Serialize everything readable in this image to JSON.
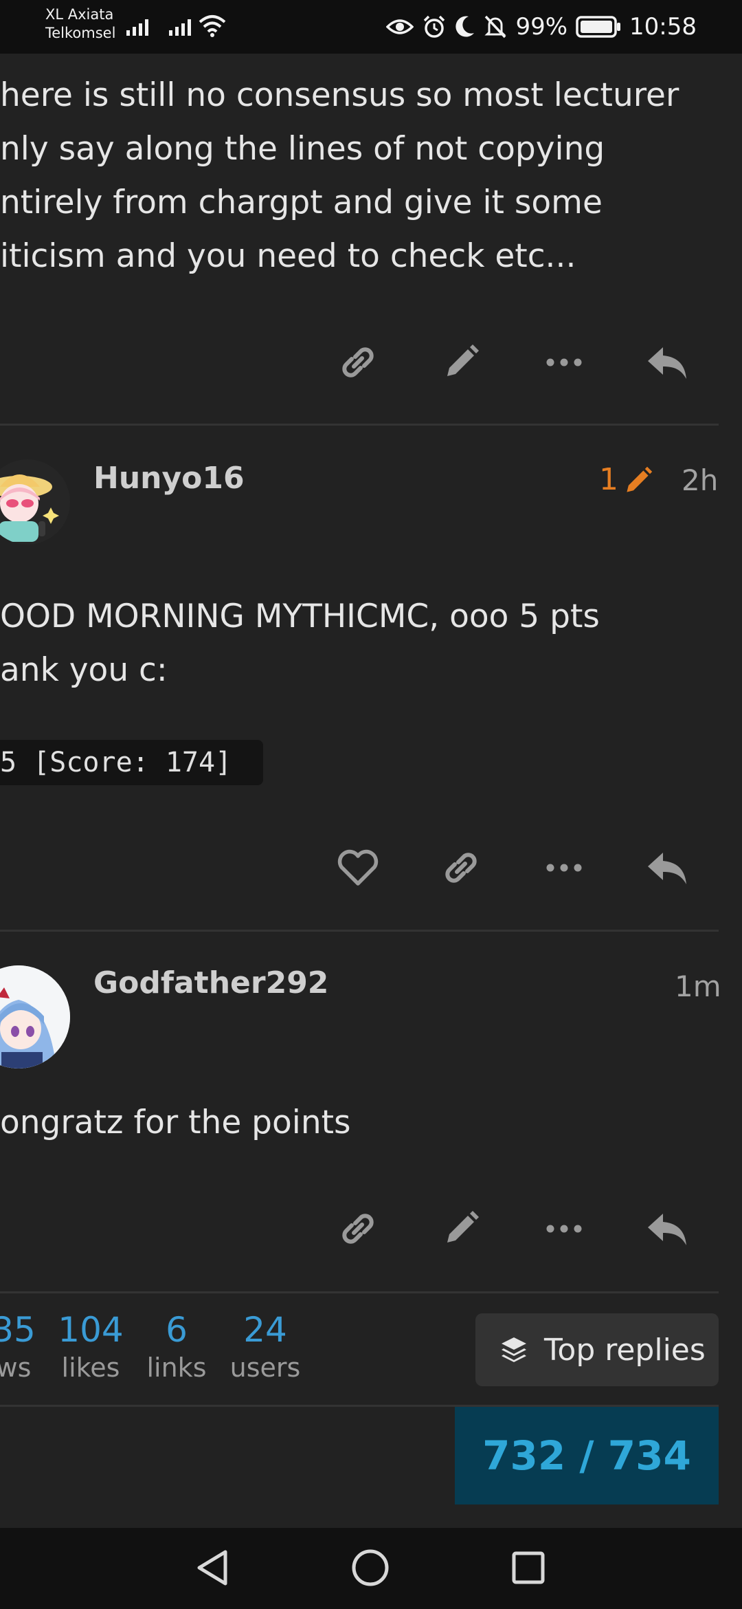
{
  "status_bar": {
    "carrier_line1": "XL Axiata",
    "carrier_line2": "Telkomsel",
    "battery": "99%",
    "time": "10:58"
  },
  "posts": [
    {
      "text_lines": [
        "here is still no consensus so most lecturer",
        "nly say along the lines of not copying",
        "ntirely from chargpt and give it some",
        "iticism and you need to check etc..."
      ]
    },
    {
      "username": "Hunyo16",
      "edit_count": "1",
      "time": "2h",
      "text_lines": [
        "OOD MORNING MYTHICMC, ooo 5 pts",
        "ank you c:"
      ],
      "code": "5 [Score: 174]"
    },
    {
      "username": "Godfather292",
      "time": "1m",
      "text_lines": [
        "ongratz for the points"
      ]
    }
  ],
  "topic_stats": {
    "views": "35",
    "views_label": "ws",
    "likes": "104",
    "likes_label": "likes",
    "links": "6",
    "links_label": "links",
    "users": "24",
    "users_label": "users"
  },
  "top_replies_label": "Top replies",
  "progress": "732 / 734",
  "colors": {
    "background": "#222222",
    "accent_blue": "#3a9bd5",
    "edit_orange": "#e67e22",
    "progress_bg": "#063c52"
  }
}
